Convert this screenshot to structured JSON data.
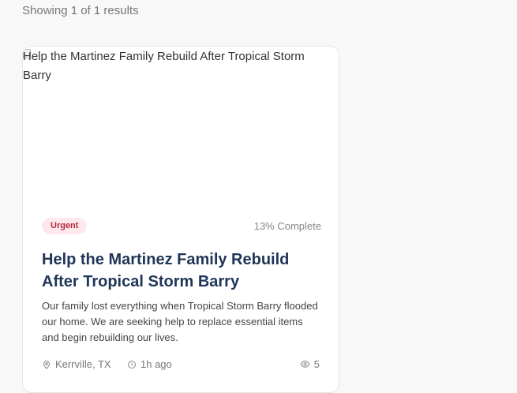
{
  "results": {
    "count_text": "Showing 1 of 1 results"
  },
  "card": {
    "image_alt": "Help the Martinez Family Rebuild After Tropical Storm Barry",
    "badge": "Urgent",
    "progress": "13% Complete",
    "title": "Help the Martinez Family Rebuild After Tropical Storm Barry",
    "description": "Our family lost everything when Tropical Storm Barry flooded our home. We are seeking help to replace essential items and begin rebuilding our lives.",
    "location": "Kerrville, TX",
    "time_ago": "1h ago",
    "views": "5"
  },
  "colors": {
    "title": "#1f3558",
    "badge_bg": "#fde8ec",
    "badge_text": "#b4283c"
  },
  "icons": {
    "location": "map-pin-icon",
    "time": "clock-icon",
    "views": "eye-icon",
    "image": "broken-image-icon"
  }
}
